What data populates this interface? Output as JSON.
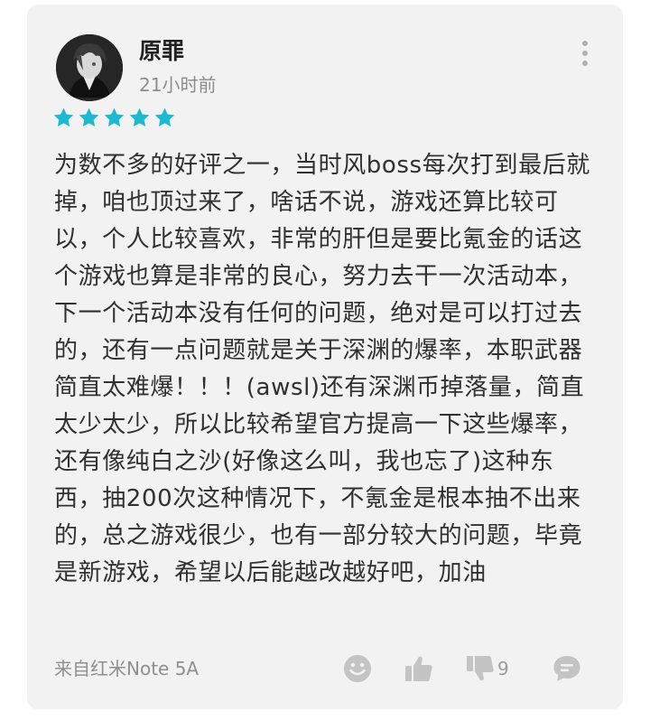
{
  "review": {
    "username": "原罪",
    "time": "21小时前",
    "rating": 5,
    "star_color": "#1fb9cf",
    "text": "为数不多的好评之一，当时风boss每次打到最后就掉，咱也顶过来了，啥话不说，游戏还算比较可以，个人比较喜欢，非常的肝但是要比氪金的话这个游戏也算是非常的良心，努力去干一次活动本，下一个活动本没有任何的问题，绝对是可以打过去的，还有一点问题就是关于深渊的爆率，本职武器简直太难爆！！！(awsl)还有深渊币掉落量，简直太少太少，所以比较希望官方提高一下这些爆率，还有像纯白之沙(好像这么叫，我也忘了)这种东西，抽200次这种情况下，不氪金是根本抽不出来的，总之游戏很少，也有一部分较大的问题，毕竟是新游戏，希望以后能越改越好吧，加油",
    "device": "来自红米Note 5A",
    "dislike_count": "9"
  },
  "icons": {
    "more": "more-vertical-icon",
    "emoji": "smiley-icon",
    "like": "thumbs-up-icon",
    "dislike": "thumbs-down-icon",
    "comment": "comment-icon"
  }
}
